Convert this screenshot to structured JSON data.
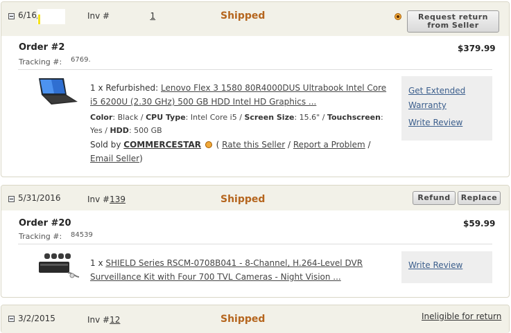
{
  "orders": [
    {
      "date": "6/16/",
      "inv_label": "Inv #",
      "inv_number": "1",
      "status": "Shipped",
      "return_button": "Request return from Seller",
      "order_label": "Order #",
      "order_number": "2",
      "tracking_label": "Tracking #:",
      "tracking_number": "6769.",
      "price": "$379.99",
      "item": {
        "qty": "1 x ",
        "condition": "Refurbished: ",
        "title": "Lenovo Flex 3 1580 80R4000DUS Ultrabook Intel Core i5 6200U (2.30 GHz) 500 GB HDD Intel HD Graphics ...",
        "specs": [
          {
            "key": "Color",
            "value": "Black"
          },
          {
            "key": "CPU Type",
            "value": "Intel Core i5"
          },
          {
            "key": "Screen Size",
            "value": "15.6\""
          },
          {
            "key": "Touchscreen",
            "value": "Yes"
          },
          {
            "key": "HDD",
            "value": "500 GB"
          }
        ],
        "sold_by": "Sold by ",
        "seller": "COMMERCESTAR",
        "rate_seller": "Rate this Seller",
        "report_problem": "Report a Problem",
        "email_seller": "Email Seller"
      },
      "side_links": [
        "Get Extended Warranty",
        "Write Review"
      ]
    },
    {
      "date": "5/31/2016",
      "inv_label": "Inv #",
      "inv_number": "139",
      "status": "Shipped",
      "buttons": [
        "Refund",
        "Replace"
      ],
      "order_label": "Order #",
      "order_number": "20",
      "tracking_label": "Tracking #:",
      "tracking_number": "84539",
      "price": "$59.99",
      "item": {
        "qty": "1 x ",
        "title": "SHIELD Series RSCM-0708B041 - 8-Channel, H.264-Level DVR Surveillance Kit with Four 700 TVL Cameras - Night Vision ..."
      },
      "side_links": [
        "Write Review"
      ]
    },
    {
      "date": "3/2/2015",
      "inv_label": "Inv #",
      "inv_number": "12",
      "status": "Shipped",
      "ineligible": "Ineligible for return"
    }
  ]
}
